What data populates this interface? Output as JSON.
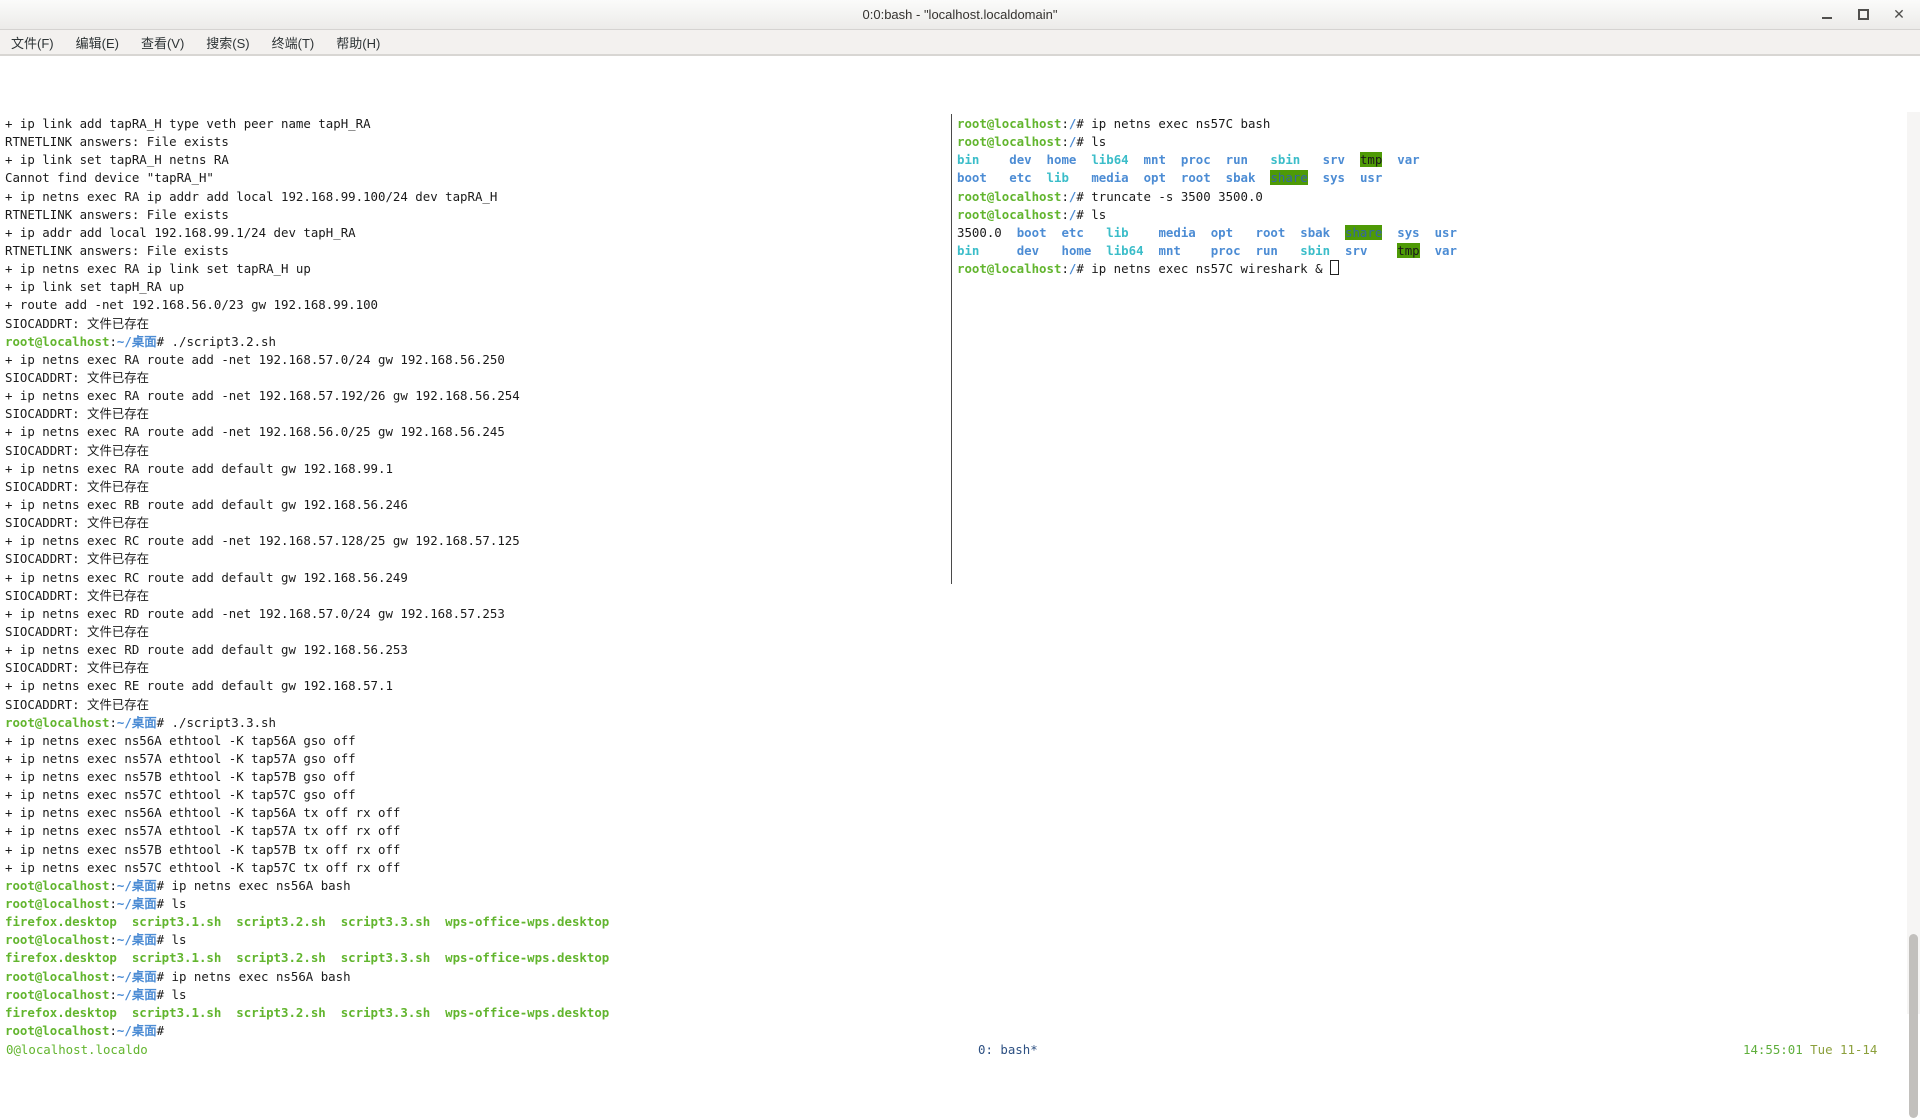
{
  "window": {
    "title": "0:0:bash - \"localhost.localdomain\"",
    "controls": [
      "minimize",
      "maximize",
      "close"
    ]
  },
  "menu": {
    "items": [
      "文件(F)",
      "编辑(E)",
      "查看(V)",
      "搜索(S)",
      "终端(T)",
      "帮助(H)"
    ]
  },
  "colors": {
    "fg": "#1a1a1a",
    "green": "#62b52e",
    "blue": "#4c8cd4",
    "cyan": "#3bbdc9",
    "dirbg": "#4e9a06",
    "sharefg": "#3465a4",
    "navy": "#2d5082",
    "time": "#5faf3c",
    "date": "#8ca03c",
    "divider": "#4a4a4a"
  },
  "terminal": {
    "left_pane": {
      "lines": [
        {
          "segs": [
            [
              "+ ip link add tapRA_H type veth peer name tapH_RA",
              "fg"
            ]
          ]
        },
        {
          "segs": [
            [
              "RTNETLINK answers: File exists",
              "fg"
            ]
          ]
        },
        {
          "segs": [
            [
              "+ ip link set tapRA_H netns RA",
              "fg"
            ]
          ]
        },
        {
          "segs": [
            [
              "Cannot find device \"tapRA_H\"",
              "fg"
            ]
          ]
        },
        {
          "segs": [
            [
              "+ ip netns exec RA ip addr add local 192.168.99.100/24 dev tapRA_H",
              "fg"
            ]
          ]
        },
        {
          "segs": [
            [
              "RTNETLINK answers: File exists",
              "fg"
            ]
          ]
        },
        {
          "segs": [
            [
              "+ ip addr add local 192.168.99.1/24 dev tapH_RA",
              "fg"
            ]
          ]
        },
        {
          "segs": [
            [
              "RTNETLINK answers: File exists",
              "fg"
            ]
          ]
        },
        {
          "segs": [
            [
              "+ ip netns exec RA ip link set tapRA_H up",
              "fg"
            ]
          ]
        },
        {
          "segs": [
            [
              "+ ip link set tapH_RA up",
              "fg"
            ]
          ]
        },
        {
          "segs": [
            [
              "+ route add -net 192.168.56.0/23 gw 192.168.99.100",
              "fg"
            ]
          ]
        },
        {
          "segs": [
            [
              "SIOCADDRT: 文件已存在",
              "fg"
            ]
          ]
        },
        {
          "segs": [
            [
              "root@localhost",
              "green"
            ],
            [
              ":",
              "fg"
            ],
            [
              "~/桌面",
              "blue"
            ],
            [
              "# ",
              "fg"
            ],
            [
              "./script3.2.sh",
              "fg"
            ]
          ]
        },
        {
          "segs": [
            [
              "+ ip netns exec RA route add -net 192.168.57.0/24 gw 192.168.56.250",
              "fg"
            ]
          ]
        },
        {
          "segs": [
            [
              "SIOCADDRT: 文件已存在",
              "fg"
            ]
          ]
        },
        {
          "segs": [
            [
              "+ ip netns exec RA route add -net 192.168.57.192/26 gw 192.168.56.254",
              "fg"
            ]
          ]
        },
        {
          "segs": [
            [
              "SIOCADDRT: 文件已存在",
              "fg"
            ]
          ]
        },
        {
          "segs": [
            [
              "+ ip netns exec RA route add -net 192.168.56.0/25 gw 192.168.56.245",
              "fg"
            ]
          ]
        },
        {
          "segs": [
            [
              "SIOCADDRT: 文件已存在",
              "fg"
            ]
          ]
        },
        {
          "segs": [
            [
              "+ ip netns exec RA route add default gw 192.168.99.1",
              "fg"
            ]
          ]
        },
        {
          "segs": [
            [
              "SIOCADDRT: 文件已存在",
              "fg"
            ]
          ]
        },
        {
          "segs": [
            [
              "+ ip netns exec RB route add default gw 192.168.56.246",
              "fg"
            ]
          ]
        },
        {
          "segs": [
            [
              "SIOCADDRT: 文件已存在",
              "fg"
            ]
          ]
        },
        {
          "segs": [
            [
              "+ ip netns exec RC route add -net 192.168.57.128/25 gw 192.168.57.125",
              "fg"
            ]
          ]
        },
        {
          "segs": [
            [
              "SIOCADDRT: 文件已存在",
              "fg"
            ]
          ]
        },
        {
          "segs": [
            [
              "+ ip netns exec RC route add default gw 192.168.56.249",
              "fg"
            ]
          ]
        },
        {
          "segs": [
            [
              "SIOCADDRT: 文件已存在",
              "fg"
            ]
          ]
        },
        {
          "segs": [
            [
              "+ ip netns exec RD route add -net 192.168.57.0/24 gw 192.168.57.253",
              "fg"
            ]
          ]
        },
        {
          "segs": [
            [
              "SIOCADDRT: 文件已存在",
              "fg"
            ]
          ]
        },
        {
          "segs": [
            [
              "+ ip netns exec RD route add default gw 192.168.56.253",
              "fg"
            ]
          ]
        },
        {
          "segs": [
            [
              "SIOCADDRT: 文件已存在",
              "fg"
            ]
          ]
        },
        {
          "segs": [
            [
              "+ ip netns exec RE route add default gw 192.168.57.1",
              "fg"
            ]
          ]
        },
        {
          "segs": [
            [
              "SIOCADDRT: 文件已存在",
              "fg"
            ]
          ]
        },
        {
          "segs": [
            [
              "root@localhost",
              "green"
            ],
            [
              ":",
              "fg"
            ],
            [
              "~/桌面",
              "blue"
            ],
            [
              "# ",
              "fg"
            ],
            [
              "./script3.3.sh",
              "fg"
            ]
          ]
        },
        {
          "segs": [
            [
              "+ ip netns exec ns56A ethtool -K tap56A gso off",
              "fg"
            ]
          ]
        },
        {
          "segs": [
            [
              "+ ip netns exec ns57A ethtool -K tap57A gso off",
              "fg"
            ]
          ]
        },
        {
          "segs": [
            [
              "+ ip netns exec ns57B ethtool -K tap57B gso off",
              "fg"
            ]
          ]
        },
        {
          "segs": [
            [
              "+ ip netns exec ns57C ethtool -K tap57C gso off",
              "fg"
            ]
          ]
        },
        {
          "segs": [
            [
              "+ ip netns exec ns56A ethtool -K tap56A tx off rx off",
              "fg"
            ]
          ]
        },
        {
          "segs": [
            [
              "+ ip netns exec ns57A ethtool -K tap57A tx off rx off",
              "fg"
            ]
          ]
        },
        {
          "segs": [
            [
              "+ ip netns exec ns57B ethtool -K tap57B tx off rx off",
              "fg"
            ]
          ]
        },
        {
          "segs": [
            [
              "+ ip netns exec ns57C ethtool -K tap57C tx off rx off",
              "fg"
            ]
          ]
        },
        {
          "segs": [
            [
              "root@localhost",
              "green"
            ],
            [
              ":",
              "fg"
            ],
            [
              "~/桌面",
              "blue"
            ],
            [
              "# ",
              "fg"
            ],
            [
              "ip netns exec ns56A bash",
              "fg"
            ]
          ]
        },
        {
          "segs": [
            [
              "root@localhost",
              "green"
            ],
            [
              ":",
              "fg"
            ],
            [
              "~/桌面",
              "blue"
            ],
            [
              "# ",
              "fg"
            ],
            [
              "ls",
              "fg"
            ]
          ]
        },
        {
          "segs": [
            [
              "firefox.desktop  script3.1.sh  script3.2.sh  script3.3.sh  wps-office-wps.desktop",
              "green"
            ]
          ]
        },
        {
          "segs": [
            [
              "root@localhost",
              "green"
            ],
            [
              ":",
              "fg"
            ],
            [
              "~/桌面",
              "blue"
            ],
            [
              "# ",
              "fg"
            ],
            [
              "ls",
              "fg"
            ]
          ]
        },
        {
          "segs": [
            [
              "firefox.desktop  script3.1.sh  script3.2.sh  script3.3.sh  wps-office-wps.desktop",
              "green"
            ]
          ]
        },
        {
          "segs": [
            [
              "root@localhost",
              "green"
            ],
            [
              ":",
              "fg"
            ],
            [
              "~/桌面",
              "blue"
            ],
            [
              "# ",
              "fg"
            ],
            [
              "ip netns exec ns56A bash",
              "fg"
            ]
          ]
        },
        {
          "segs": [
            [
              "root@localhost",
              "green"
            ],
            [
              ":",
              "fg"
            ],
            [
              "~/桌面",
              "blue"
            ],
            [
              "# ",
              "fg"
            ],
            [
              "ls",
              "fg"
            ]
          ]
        },
        {
          "segs": [
            [
              "firefox.desktop  script3.1.sh  script3.2.sh  script3.3.sh  wps-office-wps.desktop",
              "green"
            ]
          ]
        },
        {
          "segs": [
            [
              "root@localhost",
              "green"
            ],
            [
              ":",
              "fg"
            ],
            [
              "~/桌面",
              "blue"
            ],
            [
              "# ",
              "fg"
            ]
          ]
        }
      ]
    },
    "right_pane": {
      "lines": [
        {
          "segs": [
            [
              "root@localhost",
              "green"
            ],
            [
              ":",
              "fg"
            ],
            [
              "/",
              "blue"
            ],
            [
              "# ",
              "fg"
            ],
            [
              "ip netns exec ns57C bash",
              "fg"
            ]
          ]
        },
        {
          "segs": [
            [
              "root@localhost",
              "green"
            ],
            [
              ":",
              "fg"
            ],
            [
              "/",
              "blue"
            ],
            [
              "# ",
              "fg"
            ],
            [
              "ls",
              "fg"
            ]
          ]
        },
        {
          "segs": [
            [
              "bin",
              "cyan"
            ],
            [
              "    ",
              "fg"
            ],
            [
              "dev",
              "blue"
            ],
            [
              "  ",
              "fg"
            ],
            [
              "home",
              "blue"
            ],
            [
              "  ",
              "fg"
            ],
            [
              "lib64",
              "cyan"
            ],
            [
              "  ",
              "fg"
            ],
            [
              "mnt",
              "blue"
            ],
            [
              "  ",
              "fg"
            ],
            [
              "proc",
              "blue"
            ],
            [
              "  ",
              "fg"
            ],
            [
              "run",
              "blue"
            ],
            [
              "   ",
              "fg"
            ],
            [
              "sbin",
              "cyan"
            ],
            [
              "   ",
              "fg"
            ],
            [
              "srv",
              "blue"
            ],
            [
              "  ",
              "fg"
            ],
            [
              "tmp",
              "tw"
            ],
            [
              "  ",
              "fg"
            ],
            [
              "var",
              "blue"
            ]
          ]
        },
        {
          "segs": [
            [
              "boot",
              "blue"
            ],
            [
              "   ",
              "fg"
            ],
            [
              "etc",
              "blue"
            ],
            [
              "  ",
              "fg"
            ],
            [
              "lib",
              "cyan"
            ],
            [
              "   ",
              "fg"
            ],
            [
              "media",
              "blue"
            ],
            [
              "  ",
              "fg"
            ],
            [
              "opt",
              "blue"
            ],
            [
              "  ",
              "fg"
            ],
            [
              "root",
              "blue"
            ],
            [
              "  ",
              "fg"
            ],
            [
              "sbak",
              "blue"
            ],
            [
              "  ",
              "fg"
            ],
            [
              "share",
              "ow"
            ],
            [
              "  ",
              "fg"
            ],
            [
              "sys",
              "blue"
            ],
            [
              "  ",
              "fg"
            ],
            [
              "usr",
              "blue"
            ]
          ]
        },
        {
          "segs": [
            [
              "root@localhost",
              "green"
            ],
            [
              ":",
              "fg"
            ],
            [
              "/",
              "blue"
            ],
            [
              "# ",
              "fg"
            ],
            [
              "truncate -s 3500 3500.0",
              "fg"
            ]
          ]
        },
        {
          "segs": [
            [
              "root@localhost",
              "green"
            ],
            [
              ":",
              "fg"
            ],
            [
              "/",
              "blue"
            ],
            [
              "# ",
              "fg"
            ],
            [
              "ls",
              "fg"
            ]
          ]
        },
        {
          "segs": [
            [
              "3500.0",
              "fg"
            ],
            [
              "  ",
              "fg"
            ],
            [
              "boot",
              "blue"
            ],
            [
              "  ",
              "fg"
            ],
            [
              "etc",
              "blue"
            ],
            [
              "   ",
              "fg"
            ],
            [
              "lib",
              "cyan"
            ],
            [
              "    ",
              "fg"
            ],
            [
              "media",
              "blue"
            ],
            [
              "  ",
              "fg"
            ],
            [
              "opt",
              "blue"
            ],
            [
              "   ",
              "fg"
            ],
            [
              "root",
              "blue"
            ],
            [
              "  ",
              "fg"
            ],
            [
              "sbak",
              "blue"
            ],
            [
              "  ",
              "fg"
            ],
            [
              "share",
              "ow"
            ],
            [
              "  ",
              "fg"
            ],
            [
              "sys",
              "blue"
            ],
            [
              "  ",
              "fg"
            ],
            [
              "usr",
              "blue"
            ]
          ]
        },
        {
          "segs": [
            [
              "bin",
              "cyan"
            ],
            [
              "     ",
              "fg"
            ],
            [
              "dev",
              "blue"
            ],
            [
              "   ",
              "fg"
            ],
            [
              "home",
              "blue"
            ],
            [
              "  ",
              "fg"
            ],
            [
              "lib64",
              "cyan"
            ],
            [
              "  ",
              "fg"
            ],
            [
              "mnt",
              "blue"
            ],
            [
              "    ",
              "fg"
            ],
            [
              "proc",
              "blue"
            ],
            [
              "  ",
              "fg"
            ],
            [
              "run",
              "blue"
            ],
            [
              "   ",
              "fg"
            ],
            [
              "sbin",
              "cyan"
            ],
            [
              "  ",
              "fg"
            ],
            [
              "srv",
              "blue"
            ],
            [
              "    ",
              "fg"
            ],
            [
              "tmp",
              "tw"
            ],
            [
              "  ",
              "fg"
            ],
            [
              "var",
              "blue"
            ]
          ]
        },
        {
          "segs": [
            [
              "root@localhost",
              "green"
            ],
            [
              ":",
              "fg"
            ],
            [
              "/",
              "blue"
            ],
            [
              "# ",
              "fg"
            ],
            [
              "ip netns exec ns57C wireshark & ",
              "fg"
            ]
          ],
          "cursor": true
        }
      ]
    }
  },
  "status_bar": {
    "left": "0@localhost.localdo",
    "center": "0: bash*",
    "right_time": "14:55:01",
    "right_date": "Tue 11-14"
  }
}
